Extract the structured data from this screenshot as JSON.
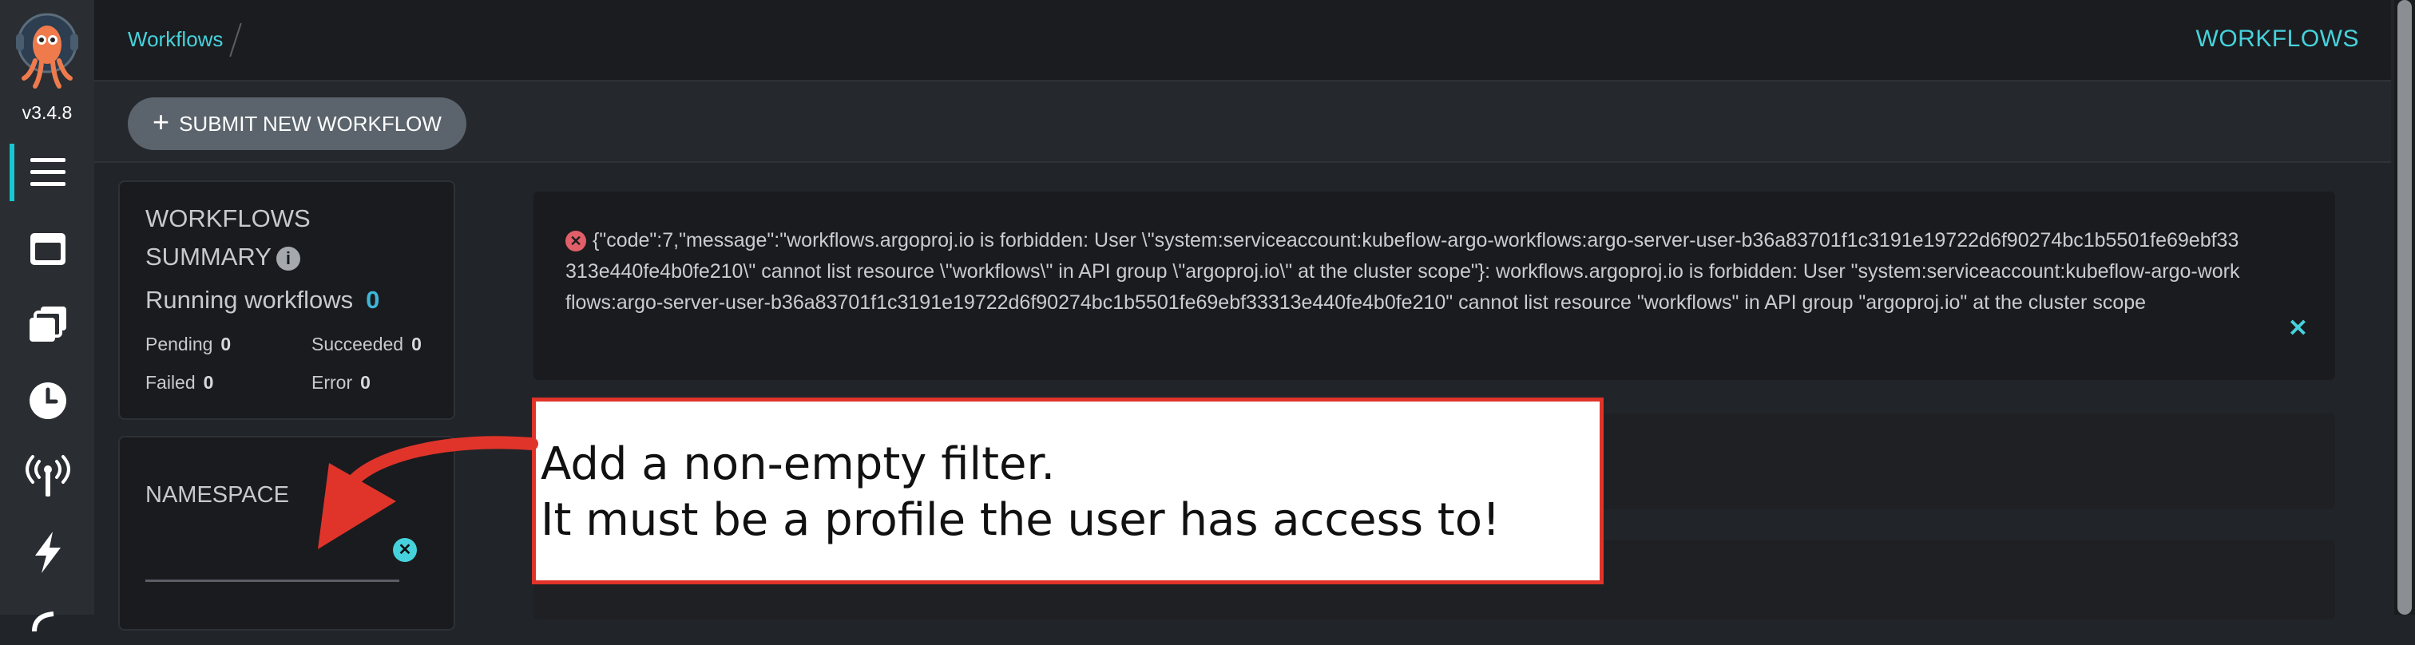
{
  "app": {
    "version": "v3.4.8",
    "accent_color": "#46d2dc"
  },
  "sidebar": {
    "items": [
      {
        "icon": "menu-icon",
        "active": true
      },
      {
        "icon": "templates-icon"
      },
      {
        "icon": "cluster-templates-icon"
      },
      {
        "icon": "clock-icon"
      },
      {
        "icon": "antenna-icon"
      },
      {
        "icon": "lightning-icon"
      }
    ]
  },
  "header": {
    "breadcrumb": "Workflows",
    "title": "WORKFLOWS"
  },
  "toolbar": {
    "submit_label": "SUBMIT NEW WORKFLOW"
  },
  "summary": {
    "title": "WORKFLOWS SUMMARY",
    "running_label": "Running workflows",
    "running_count": "0",
    "pending_label": "Pending",
    "pending_count": "0",
    "succeeded_label": "Succeeded",
    "succeeded_count": "0",
    "failed_label": "Failed",
    "failed_count": "0",
    "error_label": "Error",
    "error_count": "0"
  },
  "namespace": {
    "title": "NAMESPACE",
    "value": ""
  },
  "error": {
    "message": "{\"code\":7,\"message\":\"workflows.argoproj.io is forbidden: User \\\"system:serviceaccount:kubeflow-argo-workflows:argo-server-user-b36a83701f1c3191e19722d6f90274bc1b5501fe69ebf33313e440fe4b0fe210\\\" cannot list resource \\\"workflows\\\" in API group \\\"argoproj.io\\\" at the cluster scope\"}: workflows.argoproj.io is forbidden: User \"system:serviceaccount:kubeflow-argo-workflows:argo-server-user-b36a83701f1c3191e19722d6f90274bc1b5501fe69ebf33313e440fe4b0fe210\" cannot list resource \"workflows\" in API group \"argoproj.io\" at the cluster scope",
    "close_symbol": "✕"
  },
  "annotation": {
    "text": "Add a non-empty filter.\nIt must be a profile the user has access to!",
    "border_color": "#e0342a"
  }
}
